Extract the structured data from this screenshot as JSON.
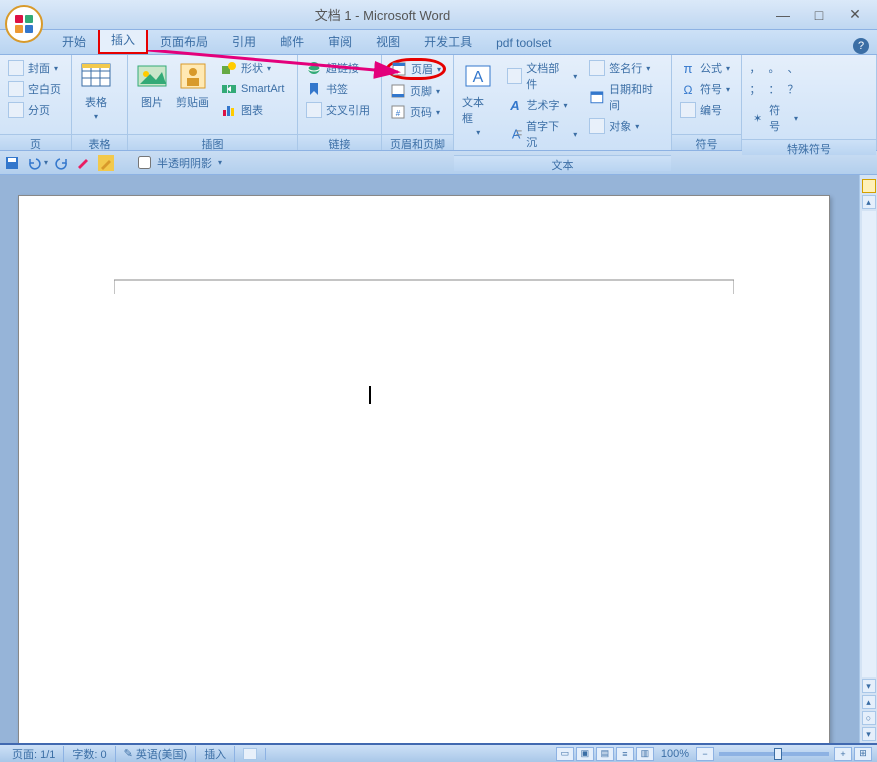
{
  "title": "文档 1 - Microsoft Word",
  "window": {
    "min": "—",
    "max": "□",
    "close": "✕"
  },
  "tabs": {
    "home": "开始",
    "insert": "插入",
    "layout": "页面布局",
    "ref": "引用",
    "mail": "邮件",
    "review": "审阅",
    "view": "视图",
    "dev": "开发工具",
    "pdf": "pdf toolset"
  },
  "ribbon": {
    "pages": {
      "cover": "封面",
      "blank": "空白页",
      "break": "分页",
      "label": "页"
    },
    "tables": {
      "table": "表格",
      "label": "表格"
    },
    "illus": {
      "picture": "图片",
      "clipart": "剪贴画",
      "shapes": "形状",
      "smartart": "SmartArt",
      "chart": "图表",
      "label": "插图"
    },
    "links": {
      "hyperlink": "超链接",
      "bookmark": "书签",
      "crossref": "交叉引用",
      "label": "链接"
    },
    "hf": {
      "header": "页眉",
      "footer": "页脚",
      "pagenum": "页码",
      "label": "页眉和页脚"
    },
    "text": {
      "textbox": "文本框",
      "parts": "文档部件",
      "wordart": "艺术字",
      "dropcap": "首字下沉",
      "sig": "签名行",
      "datetime": "日期和时间",
      "object": "对象",
      "label": "文本"
    },
    "symbols": {
      "equation": "公式",
      "symbol": "符号",
      "number": "编号",
      "label": "符号"
    },
    "special": {
      "sym1": "，",
      "sym2": "。",
      "sym3": "、",
      "sym4": "；",
      "sym5": "：",
      "sym6": "？",
      "more": "符号",
      "label": "特殊符号"
    }
  },
  "qat": {
    "shadow": "半透明阴影"
  },
  "status": {
    "page": "页面: 1/1",
    "words": "字数: 0",
    "lang": "英语(美国)",
    "mode": "插入",
    "zoom": "100%"
  }
}
